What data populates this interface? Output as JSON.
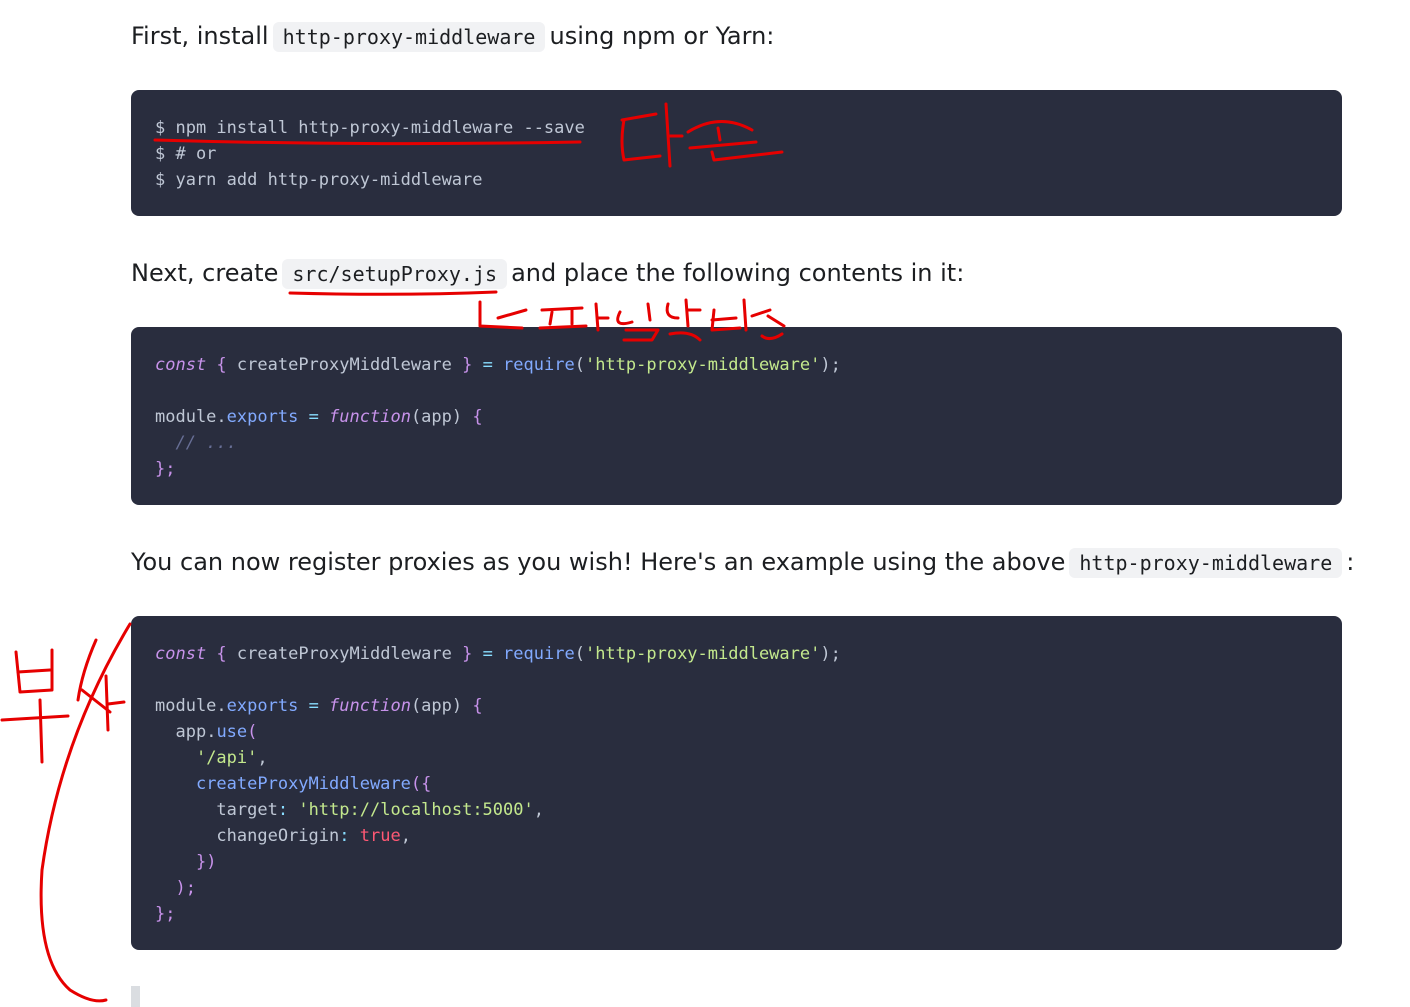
{
  "para1": {
    "before": "First, install",
    "code": "http-proxy-middleware",
    "after": "using npm or Yarn:"
  },
  "block1": {
    "line1": "$ npm install http-proxy-middleware --save",
    "line2": "$ # or",
    "line3": "$ yarn add http-proxy-middleware"
  },
  "para2": {
    "before": "Next, create",
    "code": "src/setupProxy.js",
    "after": "and place the following contents in it:"
  },
  "block2": {
    "t_const": "const",
    "t_lb": " { ",
    "t_cpm": "createProxyMiddleware",
    "t_rb": " } ",
    "t_eq": "=",
    "t_require": " require",
    "t_lp": "(",
    "t_mod": "'http-proxy-middleware'",
    "t_rpsemi": ");",
    "t_module": "module",
    "t_dot": ".",
    "t_exports": "exports",
    "t_eq2": " = ",
    "t_function": "function",
    "t_args": "(app)",
    "t_open": " {",
    "t_comment": "  // ...",
    "t_close": "};"
  },
  "para3": {
    "before": "You can now register proxies as you wish! Here's an example using the above",
    "code": "http-proxy-middleware",
    "after": ":"
  },
  "block3": {
    "t_const": "const",
    "t_lb": " { ",
    "t_cpm": "createProxyMiddleware",
    "t_rb": " } ",
    "t_eq": "=",
    "t_require": " require",
    "t_lp": "(",
    "t_mod": "'http-proxy-middleware'",
    "t_rpsemi": ");",
    "t_module": "module",
    "t_dot": ".",
    "t_exports": "exports",
    "t_eq2": " = ",
    "t_function": "function",
    "t_args": "(app)",
    "t_open": " {",
    "t_app": "  app",
    "t_use": "use",
    "t_use_lp": "(",
    "t_api": "'/api'",
    "t_comma": ",",
    "t_cpm2": "createProxyMiddleware",
    "t_obj_open": "({",
    "t_target": "target",
    "t_colon": ": ",
    "t_url": "'http://localhost:5000'",
    "t_change": "changeOrigin",
    "t_true": "true",
    "t_obj_close": "})",
    "t_use_close": ");",
    "t_close": "};"
  },
  "annotations": {
    "color": "#e60000",
    "note_install": "다운",
    "note_create_file": "파일생성",
    "note_copy": "복사"
  },
  "colors": {
    "code_bg": "#292d3e",
    "keyword": "#c792ea",
    "function": "#82aaff",
    "string": "#c3e88d",
    "comment": "#676e95",
    "boolean": "#ff5874",
    "plain": "#bfc7d5"
  }
}
